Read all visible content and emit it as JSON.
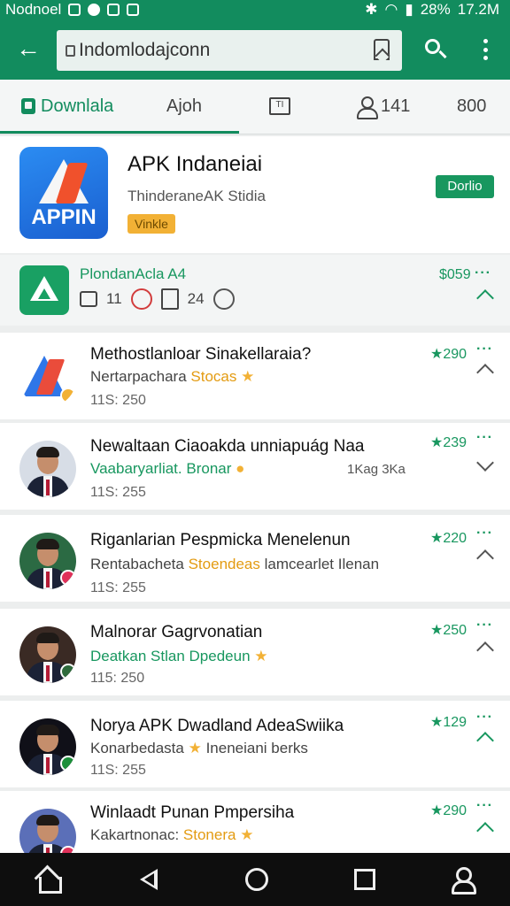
{
  "status_bar": {
    "carrier": "Nodnoel",
    "battery": "28%",
    "time": "17.2M"
  },
  "toolbar": {
    "url": "Indomlodajconn"
  },
  "tabs": [
    {
      "label": "Downlala"
    },
    {
      "label": "Ajoh"
    },
    {
      "label": "141"
    },
    {
      "label": "800"
    }
  ],
  "featured": {
    "icon_text": "APPIN",
    "title": "APK Indaneiai",
    "subtitle": "ThinderaneAK Stidia",
    "badge": "Vinkle",
    "button": "Dorlio"
  },
  "pinned": {
    "title": "PlondanAcla A4",
    "stat1": "11",
    "stat2": "24",
    "price": "$059"
  },
  "items": [
    {
      "title": "Methostlanloar Sinakellaraia?",
      "sub_a": "Nertarpachara ",
      "sub_b": "Stocas",
      "sub_c": "",
      "meta": "11S: 250",
      "extra": "",
      "price": "290"
    },
    {
      "title": "Newaltaan Ciaoakda unniapuág Naa",
      "sub_a": "Vaabaryarliat. ",
      "sub_b": "Bronar",
      "sub_c": "",
      "meta": "11S: 255",
      "extra": "1Kag 3Ka",
      "price": "239"
    },
    {
      "title": "Riganlarian Pespmicka Menelenun",
      "sub_a": "Rentabacheta ",
      "sub_b": "Stoendeas",
      "sub_c": " lamcearlet Ilenan",
      "meta": "11S: 255",
      "extra": "",
      "price": "220"
    },
    {
      "title": "Malnorar Gagrvonatian",
      "sub_a": "Deatkan ",
      "sub_b": "Stlan Dpedeun",
      "sub_c": "",
      "meta": "115: 250",
      "extra": "",
      "price": "250"
    },
    {
      "title": "Norya APK Dwadland AdeaSwiika",
      "sub_a": "Konarbedasta ",
      "sub_b": "",
      "sub_c": " Ineneiani berks",
      "meta": "11S: 255",
      "extra": "",
      "price": "129"
    },
    {
      "title": "Winlaadt Punan Pmpersiha",
      "sub_a": "Kakartnonac: ",
      "sub_b": "Stonera",
      "sub_c": "",
      "meta": "",
      "extra": "",
      "price": "290"
    }
  ],
  "colors": {
    "primary": "#128c5e",
    "accent": "#18975f",
    "star": "#f2b135",
    "nav": "#0e0e0e"
  }
}
